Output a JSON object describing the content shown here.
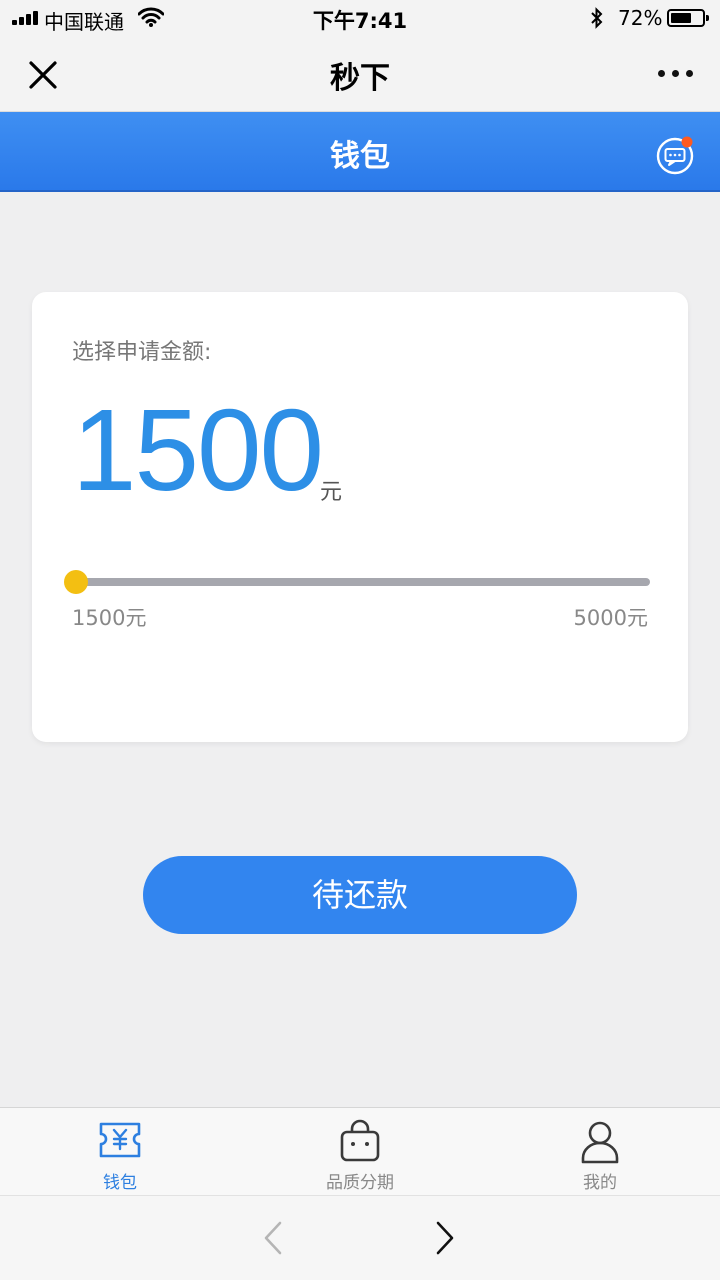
{
  "status_bar": {
    "carrier": "中国联通",
    "time": "下午7:41",
    "battery_percent": "72%",
    "battery_level": 0.72,
    "icons": [
      "signal-icon",
      "wifi-icon",
      "bluetooth-icon",
      "battery-icon"
    ]
  },
  "nav": {
    "title": "秒下",
    "close_icon": "close-icon",
    "more_icon": "more-icon"
  },
  "header": {
    "title": "钱包",
    "message_icon": "chat-bubble-icon",
    "has_notification": true
  },
  "card": {
    "label": "选择申请金额:",
    "amount": "1500",
    "unit": "元",
    "slider": {
      "min_label": "1500元",
      "max_label": "5000元",
      "min": 1500,
      "max": 5000,
      "value": 1500
    }
  },
  "button": {
    "label": "待还款"
  },
  "tabs": [
    {
      "label": "钱包",
      "icon": "wallet-yen-icon",
      "active": true
    },
    {
      "label": "品质分期",
      "icon": "shopping-bag-icon",
      "active": false
    },
    {
      "label": "我的",
      "icon": "user-icon",
      "active": false
    }
  ],
  "browser_bar": {
    "back_icon": "chevron-left-icon",
    "forward_icon": "chevron-right-icon"
  },
  "colors": {
    "header_blue": "#3285ef",
    "amount_blue": "#2d8fe6",
    "slider_thumb": "#f3bf12",
    "notification_dot": "#ff5a1f"
  }
}
